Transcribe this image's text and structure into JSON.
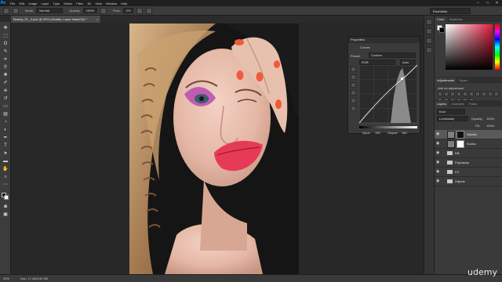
{
  "app": {
    "logo": "Ps"
  },
  "menu": [
    "File",
    "Edit",
    "Image",
    "Layer",
    "Type",
    "Select",
    "Filter",
    "3D",
    "View",
    "Window",
    "Help"
  ],
  "window_controls": [
    "–",
    "□",
    "✕"
  ],
  "options": {
    "mode_label": "Mode:",
    "mode_value": "Normal",
    "opacity_label": "Opacity:",
    "opacity_value": "100%",
    "flow_label": "Flow:",
    "flow_value": "2%",
    "workspace": "Essentials"
  },
  "document": {
    "tab_title": "Beauty_PL_2.psd @ 25% (Swiatlo, Layer Mask/16) *",
    "close": "×"
  },
  "status": {
    "zoom": "25%",
    "doc": "Doc: 17.4M/140.3M"
  },
  "properties": {
    "title": "Properties",
    "type": "Curves",
    "preset_label": "Preset:",
    "preset_value": "Custom",
    "channel": "RGB",
    "auto": "Auto",
    "input_label": "Input:",
    "input_value": "190",
    "output_label": "Output:",
    "output_value": "180"
  },
  "panels": {
    "color_tabs": [
      "Color",
      "Swatches"
    ],
    "adjust_tabs": [
      "Adjustments",
      "Styles"
    ],
    "adjust_hint": "Add an adjustment",
    "layers_tabs": [
      "Layers",
      "Channels",
      "Paths"
    ],
    "kind": "Kind",
    "blend": "Luminosity",
    "opacity_label": "Opacity:",
    "opacity_value": "100%",
    "fill_label": "Fill:",
    "fill_value": "100%",
    "layers": [
      {
        "name": "Swiatlo",
        "type": "adjustment",
        "selected": true
      },
      {
        "name": "Kontur",
        "type": "adjustment",
        "selected": false
      },
      {
        "name": "DB",
        "type": "group",
        "selected": false
      },
      {
        "name": "Poprawka",
        "type": "group",
        "selected": false
      },
      {
        "name": "FS",
        "type": "group",
        "selected": false
      },
      {
        "name": "Zdjecie",
        "type": "group",
        "selected": false
      }
    ]
  },
  "watermark": "udemy"
}
